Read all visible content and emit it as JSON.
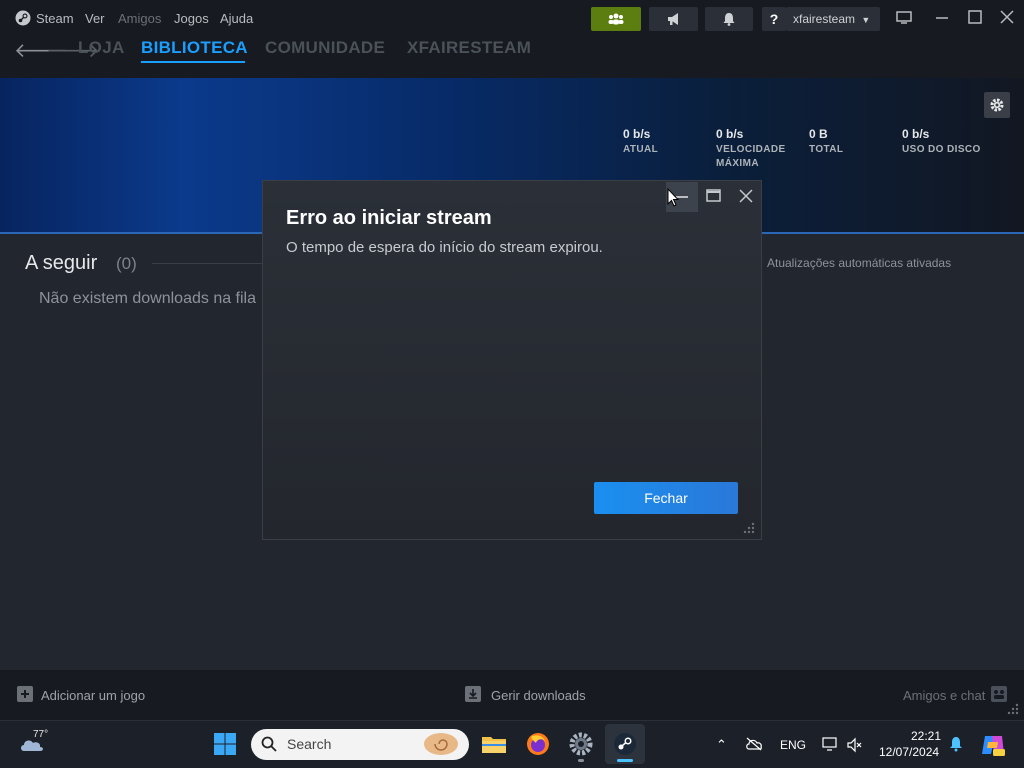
{
  "titlebar": {
    "app_name": "Steam",
    "menu": [
      "Ver",
      "Amigos",
      "Jogos",
      "Ajuda"
    ],
    "help_label": "?",
    "username": "xfairesteam"
  },
  "nav": {
    "tabs": [
      "LOJA",
      "BIBLIOTECA",
      "COMUNIDADE",
      "XFAIRESTEAM"
    ],
    "active_tab": "BIBLIOTECA"
  },
  "stats": [
    {
      "value": "0 b/s",
      "label": "ATUAL"
    },
    {
      "value": "0 b/s",
      "label": "VELOCIDADE\nMÁXIMA"
    },
    {
      "value": "0 B",
      "label": "TOTAL"
    },
    {
      "value": "0 b/s",
      "label": "USO DO DISCO"
    }
  ],
  "downloads": {
    "section_title": "A seguir",
    "section_count": "(0)",
    "empty_message": "Não existem downloads na fila",
    "auto_updates": "Atualizações automáticas ativadas"
  },
  "bottombar": {
    "add_game": "Adicionar um jogo",
    "manage_downloads": "Gerir downloads",
    "friends_chat": "Amigos e chat"
  },
  "dialog": {
    "title": "Erro ao iniciar stream",
    "message": "O tempo de espera do início do stream expirou.",
    "button": "Fechar"
  },
  "taskbar": {
    "weather_temp": "77°",
    "search_placeholder": "Search",
    "language": "ENG",
    "time": "22:21",
    "date": "12/07/2024"
  },
  "colors": {
    "accent": "#1a9fff",
    "friends_button": "#5c7e10",
    "dialog_button": "#1a8ff0"
  }
}
